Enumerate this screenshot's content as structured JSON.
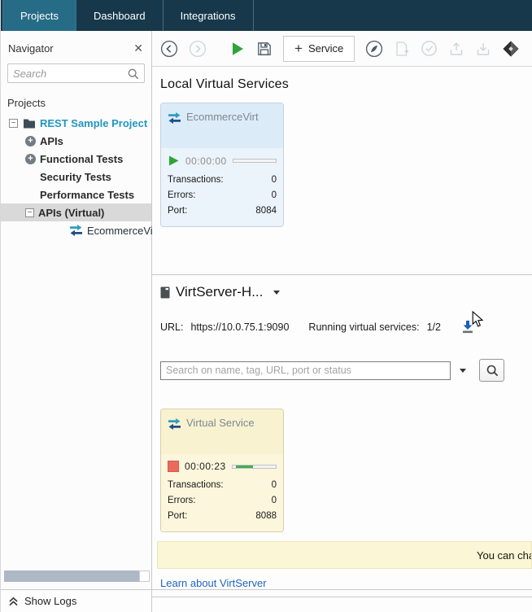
{
  "tabs": {
    "items": [
      {
        "label": "Projects",
        "active": true
      },
      {
        "label": "Dashboard",
        "active": false
      },
      {
        "label": "Integrations",
        "active": false
      }
    ]
  },
  "navigator": {
    "title": "Navigator",
    "close": "✕",
    "search_placeholder": "Search",
    "projects_label": "Projects",
    "tree": {
      "project": "REST Sample Project",
      "apis": "APIs",
      "functional": "Functional Tests",
      "security": "Security Tests",
      "performance": "Performance Tests",
      "apis_virtual": "APIs (Virtual)",
      "ecommerce": "EcommerceVir",
      "collapse_glyph": "−",
      "expand_glyph": "+"
    }
  },
  "toolbar": {
    "plus": "+",
    "service_label": "Service"
  },
  "local": {
    "title": "Local Virtual Services",
    "card": {
      "name": "EcommerceVirt",
      "time": "00:00:00",
      "transactions_label": "Transactions:",
      "transactions_value": "0",
      "errors_label": "Errors:",
      "errors_value": "0",
      "port_label": "Port:",
      "port_value": "8084"
    }
  },
  "virtserver": {
    "title": "VirtServer-H...",
    "url_label": "URL:",
    "url_value": "https://10.0.75.1:9090",
    "running_label": "Running virtual services:",
    "running_value": "1/2",
    "search_placeholder": "Search on name, tag, URL, port or status",
    "card": {
      "name": "Virtual Service",
      "time": "00:00:23",
      "transactions_label": "Transactions:",
      "transactions_value": "0",
      "errors_label": "Errors:",
      "errors_value": "0",
      "port_label": "Port:",
      "port_value": "8088"
    },
    "notification": "You can chan",
    "learn_link": "Learn about VirtServer"
  },
  "statusbar": {
    "show_logs": "Show Logs"
  },
  "colors": {
    "tab_bar": "#16384a",
    "tab_active": "#276c87",
    "accent_teal": "#2196be",
    "play_green": "#2ea43a",
    "stop_red": "#ea6a5b",
    "progress_green": "#3fae53",
    "link_blue": "#1f66c1",
    "card_blue_header": "#dcebf8",
    "card_blue_body": "#ebf3fb",
    "card_yellow_header": "#f8f2d0",
    "card_yellow_body": "#fbf6dc",
    "notification_bg": "#fbf6d5"
  }
}
